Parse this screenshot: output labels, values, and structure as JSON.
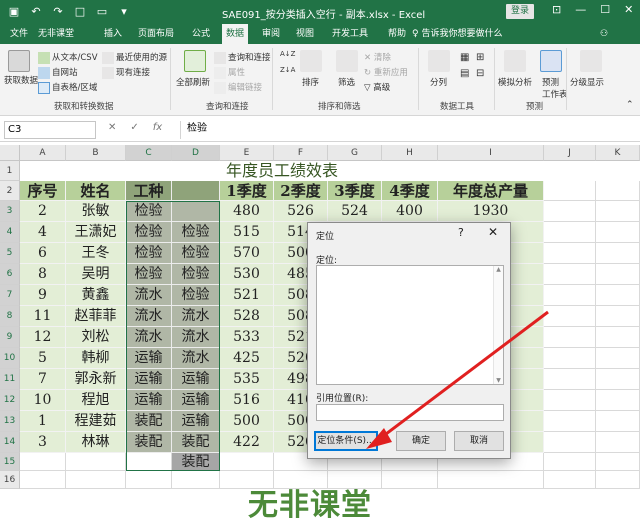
{
  "titlebar": {
    "filename": "SAE091_按分类插入空行 - 副本.xlsx  -  Excel",
    "login": "登录",
    "qat_icons": [
      "save-icon",
      "undo-icon",
      "redo-icon",
      "new-file-icon",
      "open-folder-icon",
      "customize-icon"
    ],
    "window_buttons": [
      "⊡",
      "—",
      "☐",
      "✕"
    ]
  },
  "ribbon_tabs": [
    "文件",
    "无非课堂",
    "插入",
    "页面布局",
    "公式",
    "数据",
    "审阅",
    "视图",
    "开发工具",
    "帮助"
  ],
  "active_tab": "数据",
  "tell_me": "告诉我你想要做什么",
  "ribbon": {
    "get_data_label": "获取数据",
    "from_text_csv": "从文本/CSV",
    "from_web": "自网站",
    "from_table": "自表格/区域",
    "recent_sources": "最近使用的源",
    "existing_connections": "现有连接",
    "group_get_transform": "获取和转换数据",
    "refresh_all": "全部刷新",
    "queries_connections": "查询和连接",
    "properties": "属性",
    "edit_links": "编辑链接",
    "group_queries": "查询和连接",
    "sort_asc": "A↓Z",
    "sort_desc": "Z↓A",
    "sort": "排序",
    "filter": "筛选",
    "clear": "清除",
    "reapply": "重新应用",
    "advanced": "高级",
    "group_sort_filter": "排序和筛选",
    "split": "分列",
    "group_data_tools": "数据工具",
    "whatif": "模拟分析",
    "forecast_sheet": "预测",
    "forecast_sheet2": "工作表",
    "group_forecast": "预测",
    "outline": "分级显示"
  },
  "formula_bar": {
    "name_box": "C3",
    "cancel": "✕",
    "enter": "✓",
    "fx": "fx",
    "content": "检验"
  },
  "columns": [
    "A",
    "B",
    "C",
    "D",
    "E",
    "F",
    "G",
    "H",
    "I",
    "J",
    "K"
  ],
  "rows": [
    "1",
    "2",
    "3",
    "4",
    "5",
    "6",
    "7",
    "8",
    "9",
    "10",
    "11",
    "12",
    "13",
    "14",
    "15",
    "16"
  ],
  "sheet_title": "年度员工绩效表",
  "headers": [
    "序号",
    "姓名",
    "工种",
    "",
    "1季度",
    "2季度",
    "3季度",
    "4季度",
    "年度总产量"
  ],
  "data_rows": [
    [
      "2",
      "张敏",
      "检验",
      "",
      "480",
      "526",
      "524",
      "400",
      "1930"
    ],
    [
      "4",
      "王潇妃",
      "检验",
      "检验",
      "515",
      "514",
      "",
      "",
      ""
    ],
    [
      "6",
      "王冬",
      "检验",
      "检验",
      "570",
      "500",
      "",
      "",
      ""
    ],
    [
      "8",
      "吴明",
      "检验",
      "检验",
      "530",
      "485",
      "",
      "",
      ""
    ],
    [
      "9",
      "黄鑫",
      "流水",
      "检验",
      "521",
      "508",
      "",
      "",
      ""
    ],
    [
      "11",
      "赵菲菲",
      "流水",
      "流水",
      "528",
      "508",
      "",
      "",
      ""
    ],
    [
      "12",
      "刘松",
      "流水",
      "流水",
      "533",
      "521",
      "",
      "",
      ""
    ],
    [
      "5",
      "韩柳",
      "运输",
      "流水",
      "425",
      "520",
      "",
      "",
      ""
    ],
    [
      "7",
      "郭永新",
      "运输",
      "运输",
      "535",
      "498",
      "",
      "",
      ""
    ],
    [
      "10",
      "程旭",
      "运输",
      "运输",
      "516",
      "410",
      "",
      "",
      ""
    ],
    [
      "1",
      "程建茹",
      "装配",
      "运输",
      "500",
      "500",
      "",
      "",
      ""
    ],
    [
      "3",
      "林琳",
      "装配",
      "装配",
      "422",
      "526",
      "",
      "",
      ""
    ],
    [
      "",
      "",
      "",
      "装配",
      "",
      "",
      "",
      "",
      ""
    ]
  ],
  "dialog": {
    "title": "定位",
    "help": "?",
    "close": "✕",
    "goto_label": "定位:",
    "reference_label": "引用位置(R):",
    "special_button": "定位条件(S)...",
    "ok_button": "确定",
    "cancel_button": "取消"
  },
  "watermark": "无非课堂",
  "colors": {
    "excel_green": "#217346",
    "header_fill": "#b7d09a",
    "body_fill": "#e3eed6",
    "selection_fill": "#a6a6a6",
    "arrow": "#e02020"
  }
}
